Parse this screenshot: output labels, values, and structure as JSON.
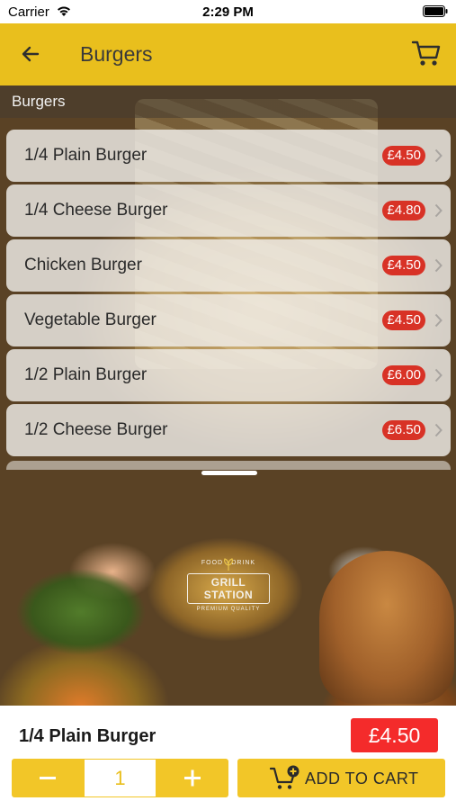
{
  "status_bar": {
    "carrier": "Carrier",
    "time": "2:29 PM"
  },
  "nav": {
    "title": "Burgers",
    "back_icon": "arrow-left-icon",
    "cart_icon": "cart-icon",
    "bar_color": "#e9bf1d"
  },
  "section": {
    "header": "Burgers"
  },
  "menu": {
    "items": [
      {
        "name": "1/4 Plain Burger",
        "price": "£4.50"
      },
      {
        "name": "1/4 Cheese Burger",
        "price": "£4.80"
      },
      {
        "name": "Chicken Burger",
        "price": "£4.50"
      },
      {
        "name": "Vegetable Burger",
        "price": "£4.50"
      },
      {
        "name": "1/2 Plain Burger",
        "price": "£6.00"
      },
      {
        "name": "1/2 Cheese Burger",
        "price": "£6.50"
      }
    ],
    "badge_color": "#d83226"
  },
  "logo": {
    "top": "FOOD · DRINK",
    "main": "GRILL STATION",
    "sub": "PREMIUM QUALITY"
  },
  "selection": {
    "name": "1/4 Plain Burger",
    "price": "£4.50",
    "quantity": "1",
    "minus_label": "−",
    "plus_label": "+",
    "add_to_cart_label": "ADD TO CART",
    "price_color": "#f42b2b",
    "button_color": "#f2c628"
  }
}
